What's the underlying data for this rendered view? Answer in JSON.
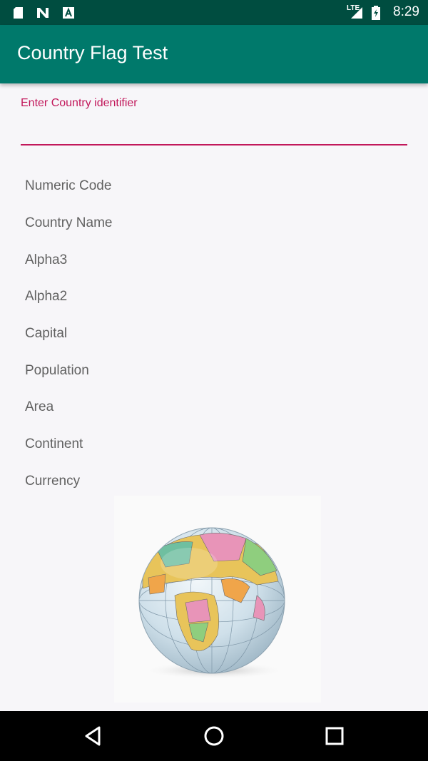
{
  "status_bar": {
    "time": "8:29",
    "network_label": "LTE",
    "icons": [
      "sd-card-icon",
      "n-app-icon",
      "a-app-icon",
      "lte-signal-icon",
      "battery-icon"
    ]
  },
  "app_bar": {
    "title": "Country Flag Test"
  },
  "form": {
    "input_label": "Enter Country identifier",
    "input_value": "",
    "fields": [
      "Numeric Code",
      "Country Name",
      "Alpha3",
      "Alpha2",
      "Capital",
      "Population",
      "Area",
      "Continent",
      "Currency"
    ]
  },
  "colors": {
    "status_bar": "#004d40",
    "app_bar": "#00796b",
    "accent": "#c2185b",
    "field_text": "#616161"
  },
  "nav_bar": {
    "buttons": [
      "back-icon",
      "home-icon",
      "recents-icon"
    ]
  }
}
